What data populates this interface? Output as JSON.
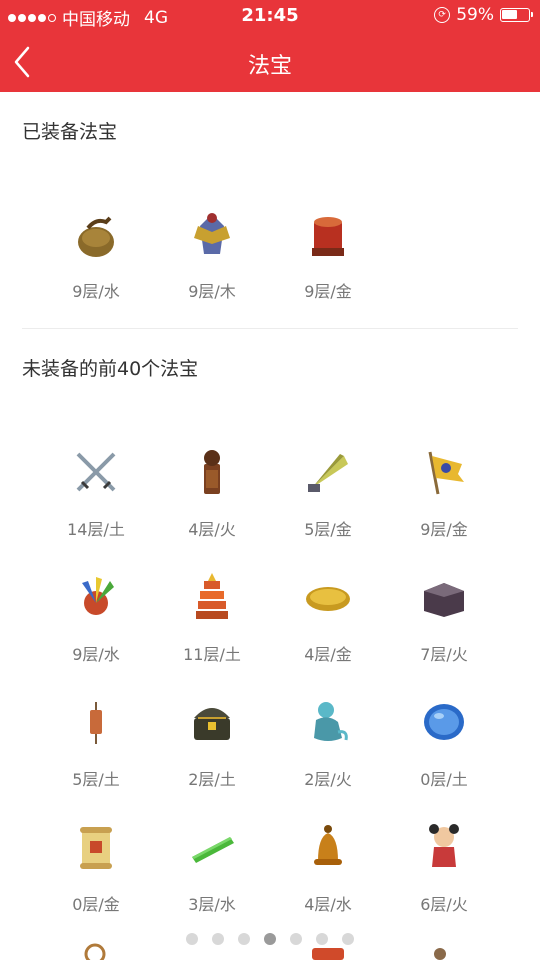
{
  "status": {
    "carrier": "中国移动",
    "network": "4G",
    "time": "21:45",
    "battery": "59%",
    "battery_level": 0.59
  },
  "header": {
    "title": "法宝"
  },
  "equipped": {
    "title": "已装备法宝",
    "items": [
      {
        "label": "9层/水",
        "icon": "pouch-icon"
      },
      {
        "label": "9层/木",
        "icon": "armor-icon"
      },
      {
        "label": "9层/金",
        "icon": "drum-icon"
      }
    ]
  },
  "unequipped": {
    "title": "未装备的前40个法宝",
    "items": [
      {
        "label": "14层/土",
        "icon": "crossed-swords-icon"
      },
      {
        "label": "4层/火",
        "icon": "seal-icon"
      },
      {
        "label": "5层/金",
        "icon": "fan-icon"
      },
      {
        "label": "9层/金",
        "icon": "flag-icon"
      },
      {
        "label": "9层/水",
        "icon": "feather-icon"
      },
      {
        "label": "11层/土",
        "icon": "pagoda-icon"
      },
      {
        "label": "4层/金",
        "icon": "gold-ingot-icon"
      },
      {
        "label": "7层/火",
        "icon": "box-icon"
      },
      {
        "label": "5层/土",
        "icon": "scroll-pendant-icon"
      },
      {
        "label": "2层/土",
        "icon": "treasure-chest-icon"
      },
      {
        "label": "2层/火",
        "icon": "genie-icon"
      },
      {
        "label": "0层/土",
        "icon": "blue-gem-icon"
      },
      {
        "label": "0层/金",
        "icon": "scroll-icon"
      },
      {
        "label": "3层/水",
        "icon": "jade-ruler-icon"
      },
      {
        "label": "4层/水",
        "icon": "bell-icon"
      },
      {
        "label": "6层/火",
        "icon": "doll-icon"
      }
    ]
  },
  "pager": {
    "count": 7,
    "active": 3
  }
}
